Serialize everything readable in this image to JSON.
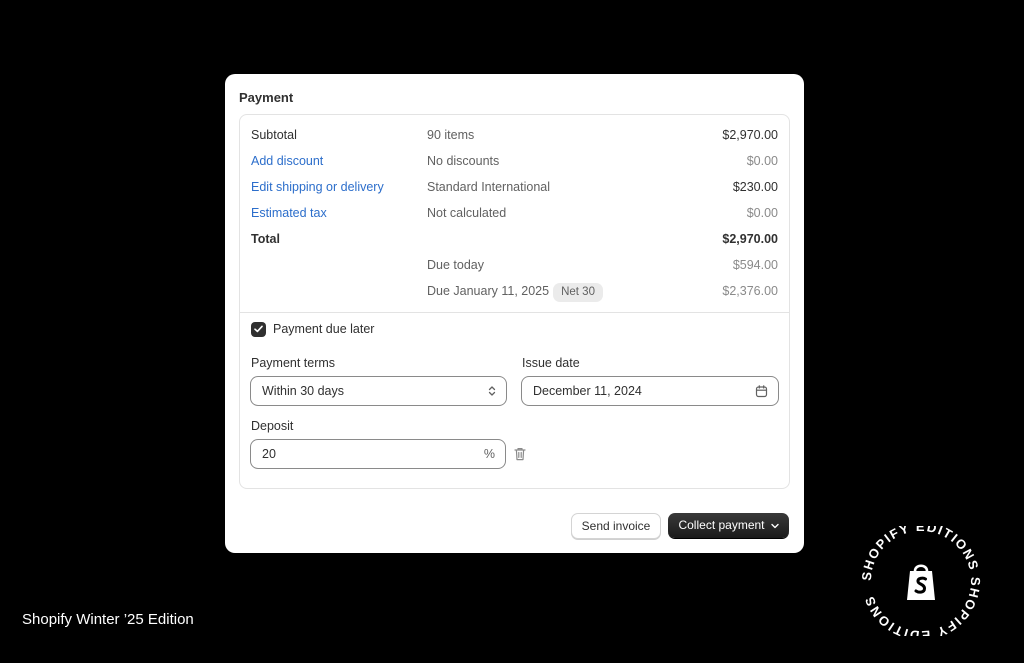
{
  "card": {
    "title": "Payment",
    "rows": [
      {
        "label": "Subtotal",
        "detail": "90 items",
        "amount": "$2,970.00"
      },
      {
        "label": "Add discount",
        "detail": "No discounts",
        "amount": "$0.00"
      },
      {
        "label": "Edit shipping or delivery",
        "detail": "Standard International",
        "amount": "$230.00"
      },
      {
        "label": "Estimated tax",
        "detail": "Not calculated",
        "amount": "$0.00"
      },
      {
        "label": "Total",
        "detail": "",
        "amount": "$2,970.00"
      },
      {
        "label": "",
        "detail": "Due today",
        "amount": "$594.00"
      },
      {
        "label": "",
        "detail": "Due January 11, 2025",
        "badge": "Net 30",
        "amount": "$2,376.00"
      }
    ],
    "payment_due_later": {
      "label": "Payment due later",
      "checked": true
    },
    "payment_terms": {
      "label": "Payment terms",
      "value": "Within 30 days"
    },
    "issue_date": {
      "label": "Issue date",
      "value": "December 11, 2024"
    },
    "deposit": {
      "label": "Deposit",
      "value": "20",
      "suffix": "%"
    },
    "buttons": {
      "send_invoice": "Send invoice",
      "collect_payment": "Collect payment"
    }
  },
  "footer": {
    "edition": "Shopify Winter ’25 Edition"
  },
  "logo": {
    "ring_text": "SHOPIFY EDITIONS SHOPIFY EDITIONS",
    "icon": "shopify-bag-icon"
  },
  "colors": {
    "link": "#2c6ecb",
    "primary_button": "#1a1a1a",
    "background": "#000000"
  }
}
